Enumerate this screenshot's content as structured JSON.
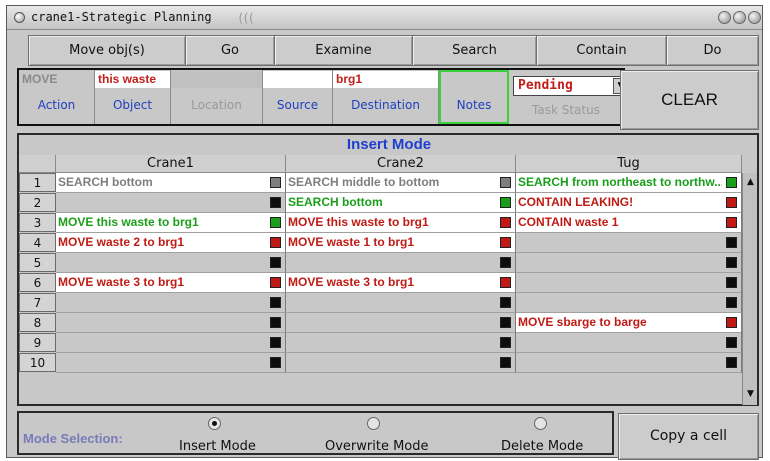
{
  "window": {
    "title": "crane1-Strategic Planning",
    "grip": "((("
  },
  "commands": [
    "Move obj(s)",
    "Go",
    "Examine",
    "Search",
    "Contain",
    "Do"
  ],
  "action_row": {
    "action": {
      "value": "MOVE",
      "label": "Action"
    },
    "object": {
      "value": "this waste",
      "label": "Object"
    },
    "location": {
      "value": "",
      "label": "Location"
    },
    "source": {
      "value": "",
      "label": "Source"
    },
    "destination": {
      "value": "brg1",
      "label": "Destination"
    },
    "notes": {
      "value": "",
      "label": "Notes"
    },
    "task_status": {
      "value": "Pending",
      "label": "Task Status"
    }
  },
  "clear_label": "CLEAR",
  "table": {
    "mode_title": "Insert Mode",
    "columns": [
      "Crane1",
      "Crane2",
      "Tug"
    ],
    "rows": [
      {
        "num": "1",
        "cells": [
          {
            "text": "SEARCH bottom",
            "color": "gray",
            "box": "gray"
          },
          {
            "text": "SEARCH middle to bottom",
            "color": "gray",
            "box": "gray"
          },
          {
            "text": "SEARCH from northeast to northw...",
            "color": "green",
            "box": "green"
          }
        ]
      },
      {
        "num": "2",
        "cells": [
          {
            "text": "",
            "color": "",
            "box": "black"
          },
          {
            "text": "SEARCH bottom",
            "color": "green",
            "box": "green"
          },
          {
            "text": "CONTAIN LEAKING!",
            "color": "red",
            "box": "red"
          }
        ]
      },
      {
        "num": "3",
        "cells": [
          {
            "text": "MOVE this waste to brg1",
            "color": "green",
            "box": "green"
          },
          {
            "text": "MOVE this waste to brg1",
            "color": "red",
            "box": "red"
          },
          {
            "text": "CONTAIN waste 1",
            "color": "red",
            "box": "red"
          }
        ]
      },
      {
        "num": "4",
        "cells": [
          {
            "text": "MOVE waste 2 to brg1",
            "color": "red",
            "box": "red"
          },
          {
            "text": "MOVE waste 1 to brg1",
            "color": "red",
            "box": "red"
          },
          {
            "text": "",
            "color": "",
            "box": "black"
          }
        ]
      },
      {
        "num": "5",
        "cells": [
          {
            "text": "",
            "color": "",
            "box": "black"
          },
          {
            "text": "",
            "color": "",
            "box": "black"
          },
          {
            "text": "",
            "color": "",
            "box": "black"
          }
        ]
      },
      {
        "num": "6",
        "cells": [
          {
            "text": "MOVE waste 3 to brg1",
            "color": "red",
            "box": "red"
          },
          {
            "text": "MOVE waste 3 to brg1",
            "color": "red",
            "box": "red"
          },
          {
            "text": "",
            "color": "",
            "box": "black"
          }
        ]
      },
      {
        "num": "7",
        "cells": [
          {
            "text": "",
            "color": "",
            "box": "black"
          },
          {
            "text": "",
            "color": "",
            "box": "black"
          },
          {
            "text": "",
            "color": "",
            "box": "black"
          }
        ]
      },
      {
        "num": "8",
        "cells": [
          {
            "text": "",
            "color": "",
            "box": "black"
          },
          {
            "text": "",
            "color": "",
            "box": "black"
          },
          {
            "text": "MOVE sbarge to barge",
            "color": "red",
            "box": "red"
          }
        ]
      },
      {
        "num": "9",
        "cells": [
          {
            "text": "",
            "color": "",
            "box": "black"
          },
          {
            "text": "",
            "color": "",
            "box": "black"
          },
          {
            "text": "",
            "color": "",
            "box": "black"
          }
        ]
      },
      {
        "num": "10",
        "cells": [
          {
            "text": "",
            "color": "",
            "box": "black"
          },
          {
            "text": "",
            "color": "",
            "box": "black"
          },
          {
            "text": "",
            "color": "",
            "box": "black"
          }
        ]
      }
    ]
  },
  "mode_selection": {
    "label": "Mode Selection:",
    "options": [
      "Insert Mode",
      "Overwrite Mode",
      "Delete Mode"
    ],
    "selected": "Insert Mode"
  },
  "copy_label": "Copy a cell",
  "colors": {
    "green": "#1a9f1a",
    "red": "#c01a14",
    "gray": "#7e7e7e",
    "black": "#0d0d0d",
    "accent_blue": "#1f3fd0"
  }
}
